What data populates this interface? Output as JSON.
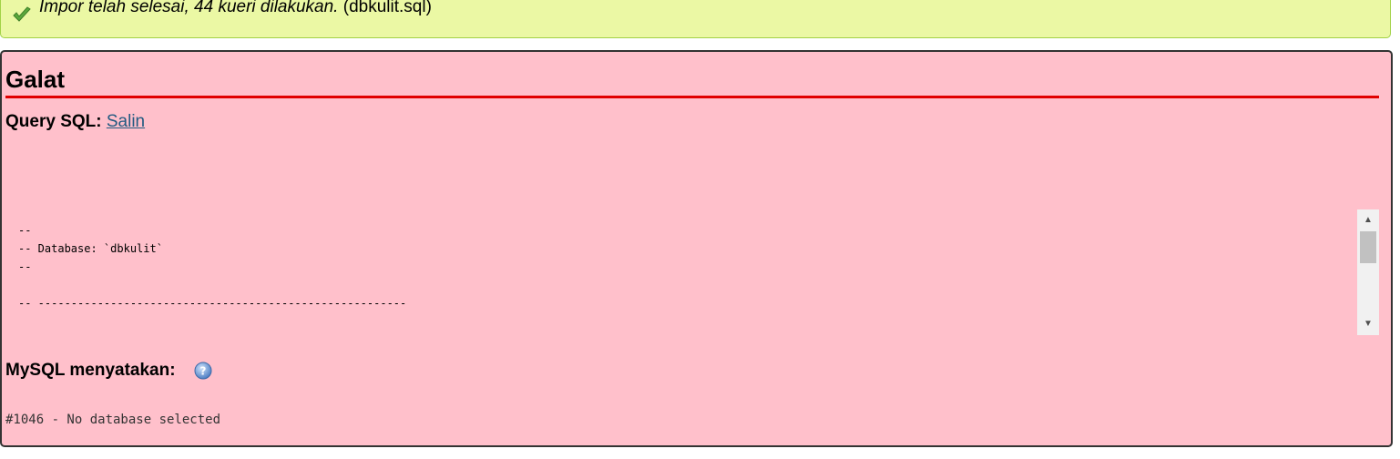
{
  "success": {
    "icon": "checkmark-icon",
    "message_italic": "Impor telah selesai, 44 kueri dilakukan.",
    "message_file": "(dbkulit.sql)"
  },
  "error": {
    "title": "Galat",
    "query_label": "Query SQL:",
    "copy_link": "Salin",
    "sql_lines": "--\n-- Database: `dbkulit`\n--\n\n-- --------------------------------------------------------",
    "mysql_label": "MySQL menyatakan:",
    "help_icon": "help-icon",
    "error_message": "#1046 - No database selected"
  },
  "colors": {
    "success_bg": "#ebf8a4",
    "error_bg": "#ffc0cb",
    "error_rule": "#e00000",
    "link": "#235a81"
  }
}
